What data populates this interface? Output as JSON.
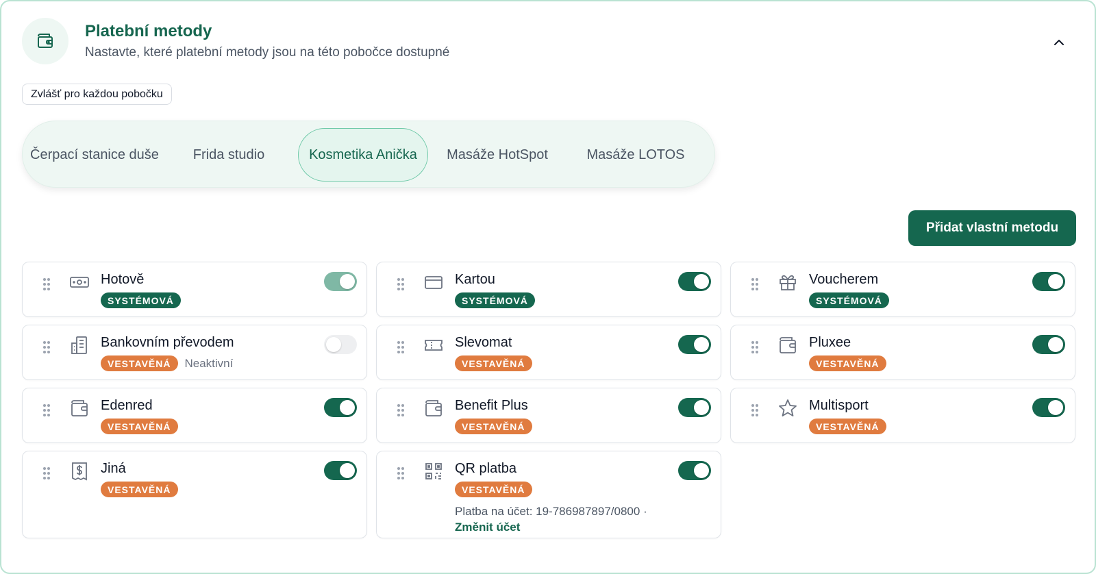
{
  "header": {
    "icon": "wallet-icon",
    "title": "Platební metody",
    "subtitle": "Nastavte, které platební metody jsou na této pobočce dostupné"
  },
  "scope_label": "Zvlášť pro každou pobočku",
  "branches": [
    {
      "label": "Čerpací stanice duše",
      "active": false
    },
    {
      "label": "Frida studio",
      "active": false
    },
    {
      "label": "Kosmetika Anička",
      "active": true
    },
    {
      "label": "Masáže HotSpot",
      "active": false
    },
    {
      "label": "Masáže LOTOS",
      "active": false
    }
  ],
  "add_button": "Přidat vlastní metodu",
  "colors": {
    "accent": "#15674f",
    "system_badge": "#15674f",
    "built_in_badge": "#e07b3f"
  },
  "methods": [
    {
      "name": "Hotově",
      "icon": "cash-icon",
      "badge": "SYSTÉMOVÁ",
      "badge_type": "system",
      "enabled": true,
      "locked": true
    },
    {
      "name": "Kartou",
      "icon": "credit-card-icon",
      "badge": "SYSTÉMOVÁ",
      "badge_type": "system",
      "enabled": true
    },
    {
      "name": "Voucherem",
      "icon": "gift-icon",
      "badge": "SYSTÉMOVÁ",
      "badge_type": "system",
      "enabled": true
    },
    {
      "name": "Bankovním převodem",
      "icon": "bank-building-icon",
      "badge": "VESTAVĚNÁ",
      "badge_type": "built",
      "enabled": false,
      "status": "Neaktivní"
    },
    {
      "name": "Slevomat",
      "icon": "ticket-icon",
      "badge": "VESTAVĚNÁ",
      "badge_type": "built",
      "enabled": true
    },
    {
      "name": "Pluxee",
      "icon": "wallet-icon",
      "badge": "VESTAVĚNÁ",
      "badge_type": "built",
      "enabled": true
    },
    {
      "name": "Edenred",
      "icon": "wallet-icon",
      "badge": "VESTAVĚNÁ",
      "badge_type": "built",
      "enabled": true
    },
    {
      "name": "Benefit Plus",
      "icon": "wallet-icon",
      "badge": "VESTAVĚNÁ",
      "badge_type": "built",
      "enabled": true
    },
    {
      "name": "Multisport",
      "icon": "star-icon",
      "badge": "VESTAVĚNÁ",
      "badge_type": "built",
      "enabled": true
    },
    {
      "name": "Jiná",
      "icon": "receipt-dollar-icon",
      "badge": "VESTAVĚNÁ",
      "badge_type": "built",
      "enabled": true
    },
    {
      "name": "QR platba",
      "icon": "qr-code-icon",
      "badge": "VESTAVĚNÁ",
      "badge_type": "built",
      "enabled": true,
      "note": "Platba na účet: 19-786987897/0800 ·",
      "link": "Změnit účet"
    }
  ]
}
